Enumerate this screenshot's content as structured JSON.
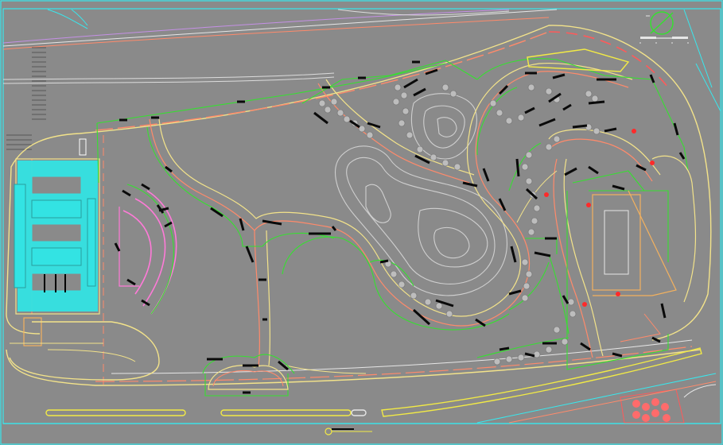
{
  "drawing": {
    "background": "#8a8a8a",
    "colors": {
      "frame": "#38e8ee",
      "path_edge": "#f3e38a",
      "path_inner": "#ff8a6b",
      "hedge_line": "#36e030",
      "contour": "#cfcfcf",
      "bench": "#0a0a0a",
      "plaza_fill": "#33e3e3",
      "arc_seating": "#ff7ad8",
      "road_white": "#e6e6e6",
      "yellow": "#f2ea45",
      "parking": "#f3b15e",
      "red_fixture": "#ff2a2a"
    },
    "icons": [
      "north-arrow-icon",
      "scale-bar-icon",
      "title-block-icon"
    ]
  }
}
